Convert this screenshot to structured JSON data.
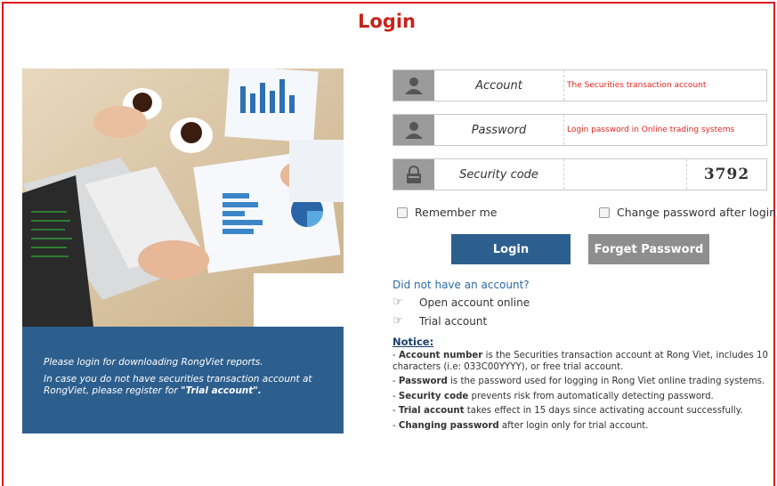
{
  "title": "Login",
  "caption": {
    "line1": "Please login for downloading RongViet reports.",
    "line2_prefix": "In case you do not have securities transaction account at RongViet, please register for ",
    "line2_bold": "\"Trial account\".",
    "line2_suffix": ""
  },
  "form": {
    "account": {
      "label": "Account",
      "placeholder": "The Securities transaction account",
      "icon": "user-icon"
    },
    "password": {
      "label": "Password",
      "placeholder": "Login password in Online trading systems",
      "icon": "user-icon"
    },
    "security": {
      "label": "Security code",
      "placeholder": "",
      "captcha": "3792",
      "icon": "lock-icon"
    },
    "remember_me": "Remember me",
    "change_password": "Change password after login",
    "login_button": "Login",
    "forget_button": "Forget Password"
  },
  "links": {
    "no_account": "Did not have an account?",
    "open_account": "Open account online",
    "trial_account": "Trial account"
  },
  "notice": {
    "title": "Notice:",
    "items": [
      {
        "prefix": "- ",
        "bold": "Account number",
        "text": " is the Securities transaction account at Rong Viet, includes 10 characters (i.e: 033C00YYYY), or free trial account."
      },
      {
        "prefix": "- ",
        "bold": "Password",
        "text": " is the password used for logging in Rong Viet online trading systems."
      },
      {
        "prefix": "- ",
        "bold": "Security code",
        "text": " prevents risk from automatically detecting password."
      },
      {
        "prefix": "- ",
        "bold": "Trial account",
        "text": " takes effect in 15 days since activating account successfully."
      },
      {
        "prefix": "- ",
        "bold": "Changing password",
        "text": " after login only for trial account."
      }
    ]
  },
  "colors": {
    "frame": "#e11b1b",
    "title": "#c8221a",
    "primary": "#2d5f8e",
    "secondary": "#8e8e8e",
    "hint": "#e0261f",
    "link": "#2d6aa4"
  }
}
